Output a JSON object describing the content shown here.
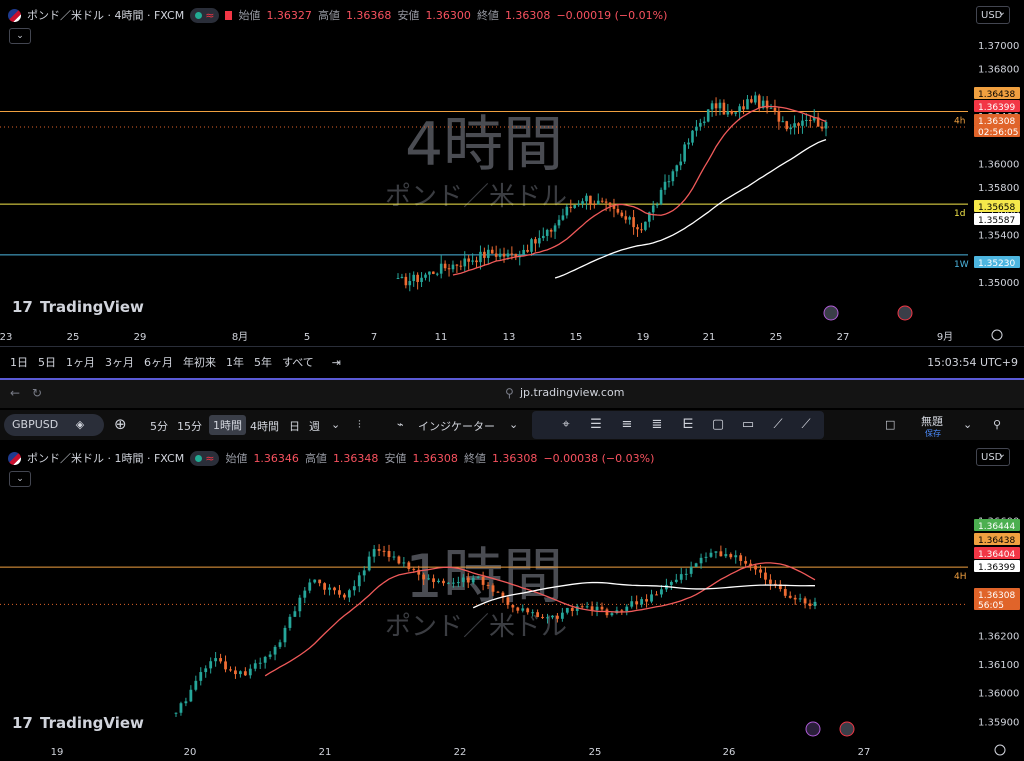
{
  "top": {
    "title": "ポンド／米ドル · 4時間 · FXCM",
    "ohlc": [
      {
        "label": "始値",
        "value": "1.36327"
      },
      {
        "label": "高値",
        "value": "1.36368"
      },
      {
        "label": "安値",
        "value": "1.36300"
      },
      {
        "label": "終値",
        "value": "1.36308"
      }
    ],
    "change": "−0.00019 (−0.01%)",
    "currency": "USD",
    "watermark_big": "4時間",
    "watermark_small": "ポンド／米ドル",
    "logo": "TradingView",
    "y_ticks": [
      "1.37000",
      "1.36800",
      "1.36600",
      "1.36400",
      "1.36000",
      "1.35800",
      "1.35600",
      "1.35400",
      "1.35000"
    ],
    "x_ticks": [
      "23",
      "25",
      "29",
      "8月",
      "5",
      "7",
      "11",
      "13",
      "15",
      "19",
      "21",
      "25",
      "27",
      "9月"
    ],
    "level_lines": [
      {
        "label": "4h",
        "price": "1.36438",
        "color": "#f0a040"
      },
      {
        "label": "1d",
        "price": "1.35658",
        "color": "#f5e84b"
      },
      {
        "label": "1W",
        "price": "1.35230",
        "color": "#4db6e0"
      }
    ],
    "price_tags": [
      {
        "text": "1.36438",
        "bg": "#f0a040"
      },
      {
        "text": "1.36399",
        "bg": "#f23645"
      },
      {
        "text": "1.36308",
        "bg": "#e0642a"
      },
      {
        "text": "02:56:05",
        "bg": "#e0642a"
      },
      {
        "text": "1.35658",
        "bg": "#f5e84b"
      },
      {
        "text": "1.35587",
        "bg": "#ffffff"
      },
      {
        "text": "1.35230",
        "bg": "#4db6e0"
      }
    ]
  },
  "timeframes": [
    "1日",
    "5日",
    "1ヶ月",
    "3ヶ月",
    "6ヶ月",
    "年初来",
    "1年",
    "5年",
    "すべて"
  ],
  "clock": "15:03:54 UTC+9",
  "browser": {
    "url": "jp.tradingview.com"
  },
  "toolbar": {
    "symbol": "GBPUSD",
    "intervals": [
      "5分",
      "15分",
      "1時間",
      "4時間",
      "日",
      "週"
    ],
    "selected_interval": "1時間",
    "indicators": "インジケーター",
    "layout_name": "無題",
    "layout_sub": "保存"
  },
  "bottom": {
    "title": "ポンド／米ドル · 1時間 · FXCM",
    "ohlc": [
      {
        "label": "始値",
        "value": "1.36346"
      },
      {
        "label": "高値",
        "value": "1.36348"
      },
      {
        "label": "安値",
        "value": "1.36308"
      },
      {
        "label": "終値",
        "value": "1.36308"
      }
    ],
    "change": "−0.00038 (−0.03%)",
    "currency": "USD",
    "watermark_big": "1時間",
    "watermark_small": "ポンド／米ドル",
    "logo": "TradingView",
    "y_ticks": [
      "1.36600",
      "1.36200",
      "1.36100",
      "1.36000",
      "1.35900"
    ],
    "x_ticks": [
      "19",
      "20",
      "21",
      "22",
      "25",
      "26",
      "27"
    ],
    "level_label": "4H",
    "price_tags": [
      {
        "text": "1.36444",
        "bg": "#4caf50"
      },
      {
        "text": "1.36438",
        "bg": "#f0a040"
      },
      {
        "text": "1.36404",
        "bg": "#f23645"
      },
      {
        "text": "1.36399",
        "bg": "#ffffff"
      },
      {
        "text": "1.36308",
        "bg": "#e0642a"
      },
      {
        "text": "56:05",
        "bg": "#e0642a"
      }
    ]
  },
  "chart_data": [
    {
      "type": "candlestick",
      "title": "ポンド／米ドル · 4時間 · FXCM",
      "xlabel": "",
      "ylabel": "",
      "x_ticks": [
        "23",
        "25",
        "29",
        "8月",
        "5",
        "7",
        "11",
        "13",
        "15",
        "19",
        "21",
        "25",
        "27",
        "9月"
      ],
      "ylim": [
        1.349,
        1.371
      ],
      "y_ticks": [
        1.37,
        1.368,
        1.366,
        1.364,
        1.36,
        1.358,
        1.356,
        1.354,
        1.35
      ],
      "last_close": 1.36308,
      "horizontal_levels": [
        1.36438,
        1.35658,
        1.3523
      ],
      "price_path_approx": [
        1.35,
        1.3503,
        1.351,
        1.3515,
        1.352,
        1.3525,
        1.3522,
        1.353,
        1.354,
        1.356,
        1.3572,
        1.3565,
        1.3555,
        1.3545,
        1.357,
        1.36,
        1.363,
        1.365,
        1.364,
        1.3655,
        1.3645,
        1.3632,
        1.364,
        1.3631
      ],
      "grid": false
    },
    {
      "type": "candlestick",
      "title": "ポンド／米ドル · 1時間 · FXCM",
      "xlabel": "",
      "ylabel": "",
      "x_ticks": [
        "19",
        "20",
        "21",
        "22",
        "25",
        "26",
        "27"
      ],
      "ylim": [
        1.3588,
        1.367
      ],
      "y_ticks": [
        1.366,
        1.362,
        1.361,
        1.36,
        1.359
      ],
      "last_close": 1.36308,
      "horizontal_levels": [
        1.36438
      ],
      "price_path_approx": [
        1.3592,
        1.3612,
        1.3606,
        1.3616,
        1.364,
        1.3633,
        1.3651,
        1.3642,
        1.3638,
        1.364,
        1.363,
        1.3625,
        1.363,
        1.3628,
        1.3633,
        1.364,
        1.365,
        1.3645,
        1.3635,
        1.3631
      ],
      "grid": false
    }
  ]
}
